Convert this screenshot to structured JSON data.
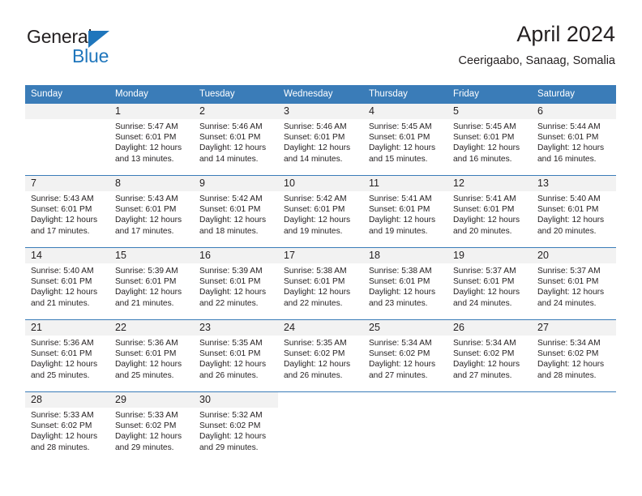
{
  "brand": {
    "name_part1": "General",
    "name_part2": "Blue"
  },
  "header": {
    "title": "April 2024",
    "subtitle": "Ceerigaabo, Sanaag, Somalia"
  },
  "colors": {
    "header_blue": "#3a7cb8",
    "brand_blue": "#1f76bc",
    "daynum_band": "#f2f2f2",
    "text": "#231f20"
  },
  "calendar": {
    "weekday_headers": [
      "Sunday",
      "Monday",
      "Tuesday",
      "Wednesday",
      "Thursday",
      "Friday",
      "Saturday"
    ],
    "weeks": [
      [
        {
          "day": "",
          "sunrise": "",
          "sunset": "",
          "daylight_line1": "",
          "daylight_line2": ""
        },
        {
          "day": "1",
          "sunrise": "Sunrise: 5:47 AM",
          "sunset": "Sunset: 6:01 PM",
          "daylight_line1": "Daylight: 12 hours",
          "daylight_line2": "and 13 minutes."
        },
        {
          "day": "2",
          "sunrise": "Sunrise: 5:46 AM",
          "sunset": "Sunset: 6:01 PM",
          "daylight_line1": "Daylight: 12 hours",
          "daylight_line2": "and 14 minutes."
        },
        {
          "day": "3",
          "sunrise": "Sunrise: 5:46 AM",
          "sunset": "Sunset: 6:01 PM",
          "daylight_line1": "Daylight: 12 hours",
          "daylight_line2": "and 14 minutes."
        },
        {
          "day": "4",
          "sunrise": "Sunrise: 5:45 AM",
          "sunset": "Sunset: 6:01 PM",
          "daylight_line1": "Daylight: 12 hours",
          "daylight_line2": "and 15 minutes."
        },
        {
          "day": "5",
          "sunrise": "Sunrise: 5:45 AM",
          "sunset": "Sunset: 6:01 PM",
          "daylight_line1": "Daylight: 12 hours",
          "daylight_line2": "and 16 minutes."
        },
        {
          "day": "6",
          "sunrise": "Sunrise: 5:44 AM",
          "sunset": "Sunset: 6:01 PM",
          "daylight_line1": "Daylight: 12 hours",
          "daylight_line2": "and 16 minutes."
        }
      ],
      [
        {
          "day": "7",
          "sunrise": "Sunrise: 5:43 AM",
          "sunset": "Sunset: 6:01 PM",
          "daylight_line1": "Daylight: 12 hours",
          "daylight_line2": "and 17 minutes."
        },
        {
          "day": "8",
          "sunrise": "Sunrise: 5:43 AM",
          "sunset": "Sunset: 6:01 PM",
          "daylight_line1": "Daylight: 12 hours",
          "daylight_line2": "and 17 minutes."
        },
        {
          "day": "9",
          "sunrise": "Sunrise: 5:42 AM",
          "sunset": "Sunset: 6:01 PM",
          "daylight_line1": "Daylight: 12 hours",
          "daylight_line2": "and 18 minutes."
        },
        {
          "day": "10",
          "sunrise": "Sunrise: 5:42 AM",
          "sunset": "Sunset: 6:01 PM",
          "daylight_line1": "Daylight: 12 hours",
          "daylight_line2": "and 19 minutes."
        },
        {
          "day": "11",
          "sunrise": "Sunrise: 5:41 AM",
          "sunset": "Sunset: 6:01 PM",
          "daylight_line1": "Daylight: 12 hours",
          "daylight_line2": "and 19 minutes."
        },
        {
          "day": "12",
          "sunrise": "Sunrise: 5:41 AM",
          "sunset": "Sunset: 6:01 PM",
          "daylight_line1": "Daylight: 12 hours",
          "daylight_line2": "and 20 minutes."
        },
        {
          "day": "13",
          "sunrise": "Sunrise: 5:40 AM",
          "sunset": "Sunset: 6:01 PM",
          "daylight_line1": "Daylight: 12 hours",
          "daylight_line2": "and 20 minutes."
        }
      ],
      [
        {
          "day": "14",
          "sunrise": "Sunrise: 5:40 AM",
          "sunset": "Sunset: 6:01 PM",
          "daylight_line1": "Daylight: 12 hours",
          "daylight_line2": "and 21 minutes."
        },
        {
          "day": "15",
          "sunrise": "Sunrise: 5:39 AM",
          "sunset": "Sunset: 6:01 PM",
          "daylight_line1": "Daylight: 12 hours",
          "daylight_line2": "and 21 minutes."
        },
        {
          "day": "16",
          "sunrise": "Sunrise: 5:39 AM",
          "sunset": "Sunset: 6:01 PM",
          "daylight_line1": "Daylight: 12 hours",
          "daylight_line2": "and 22 minutes."
        },
        {
          "day": "17",
          "sunrise": "Sunrise: 5:38 AM",
          "sunset": "Sunset: 6:01 PM",
          "daylight_line1": "Daylight: 12 hours",
          "daylight_line2": "and 22 minutes."
        },
        {
          "day": "18",
          "sunrise": "Sunrise: 5:38 AM",
          "sunset": "Sunset: 6:01 PM",
          "daylight_line1": "Daylight: 12 hours",
          "daylight_line2": "and 23 minutes."
        },
        {
          "day": "19",
          "sunrise": "Sunrise: 5:37 AM",
          "sunset": "Sunset: 6:01 PM",
          "daylight_line1": "Daylight: 12 hours",
          "daylight_line2": "and 24 minutes."
        },
        {
          "day": "20",
          "sunrise": "Sunrise: 5:37 AM",
          "sunset": "Sunset: 6:01 PM",
          "daylight_line1": "Daylight: 12 hours",
          "daylight_line2": "and 24 minutes."
        }
      ],
      [
        {
          "day": "21",
          "sunrise": "Sunrise: 5:36 AM",
          "sunset": "Sunset: 6:01 PM",
          "daylight_line1": "Daylight: 12 hours",
          "daylight_line2": "and 25 minutes."
        },
        {
          "day": "22",
          "sunrise": "Sunrise: 5:36 AM",
          "sunset": "Sunset: 6:01 PM",
          "daylight_line1": "Daylight: 12 hours",
          "daylight_line2": "and 25 minutes."
        },
        {
          "day": "23",
          "sunrise": "Sunrise: 5:35 AM",
          "sunset": "Sunset: 6:01 PM",
          "daylight_line1": "Daylight: 12 hours",
          "daylight_line2": "and 26 minutes."
        },
        {
          "day": "24",
          "sunrise": "Sunrise: 5:35 AM",
          "sunset": "Sunset: 6:02 PM",
          "daylight_line1": "Daylight: 12 hours",
          "daylight_line2": "and 26 minutes."
        },
        {
          "day": "25",
          "sunrise": "Sunrise: 5:34 AM",
          "sunset": "Sunset: 6:02 PM",
          "daylight_line1": "Daylight: 12 hours",
          "daylight_line2": "and 27 minutes."
        },
        {
          "day": "26",
          "sunrise": "Sunrise: 5:34 AM",
          "sunset": "Sunset: 6:02 PM",
          "daylight_line1": "Daylight: 12 hours",
          "daylight_line2": "and 27 minutes."
        },
        {
          "day": "27",
          "sunrise": "Sunrise: 5:34 AM",
          "sunset": "Sunset: 6:02 PM",
          "daylight_line1": "Daylight: 12 hours",
          "daylight_line2": "and 28 minutes."
        }
      ],
      [
        {
          "day": "28",
          "sunrise": "Sunrise: 5:33 AM",
          "sunset": "Sunset: 6:02 PM",
          "daylight_line1": "Daylight: 12 hours",
          "daylight_line2": "and 28 minutes."
        },
        {
          "day": "29",
          "sunrise": "Sunrise: 5:33 AM",
          "sunset": "Sunset: 6:02 PM",
          "daylight_line1": "Daylight: 12 hours",
          "daylight_line2": "and 29 minutes."
        },
        {
          "day": "30",
          "sunrise": "Sunrise: 5:32 AM",
          "sunset": "Sunset: 6:02 PM",
          "daylight_line1": "Daylight: 12 hours",
          "daylight_line2": "and 29 minutes."
        },
        {
          "day": "",
          "sunrise": "",
          "sunset": "",
          "daylight_line1": "",
          "daylight_line2": ""
        },
        {
          "day": "",
          "sunrise": "",
          "sunset": "",
          "daylight_line1": "",
          "daylight_line2": ""
        },
        {
          "day": "",
          "sunrise": "",
          "sunset": "",
          "daylight_line1": "",
          "daylight_line2": ""
        },
        {
          "day": "",
          "sunrise": "",
          "sunset": "",
          "daylight_line1": "",
          "daylight_line2": ""
        }
      ]
    ]
  }
}
